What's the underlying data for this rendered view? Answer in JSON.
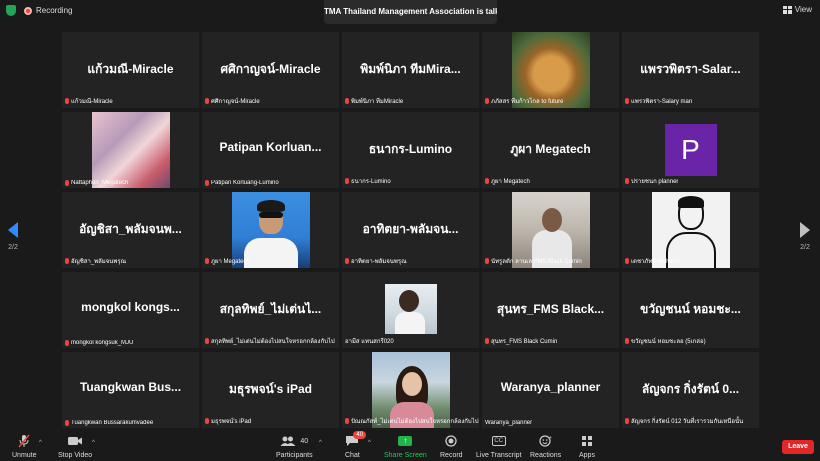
{
  "topbar": {
    "recording_label": "Recording",
    "talking_banner": "TMA Thailand Management Association is talking...",
    "view_label": "View"
  },
  "pager": {
    "left": "2/2",
    "right": "2/2"
  },
  "tiles": [
    {
      "big": "แก้วมณี-Miracle",
      "cap": "แก้วมณี-Miracle"
    },
    {
      "big": "ศศิกาญจน์-Miracle",
      "cap": "ศศิกาญจน์-Miracle"
    },
    {
      "big": "พิมพ์นิภา ทีมMira...",
      "cap": "พิมพ์นิภา ทีมMiracle"
    },
    {
      "big": "",
      "cap": "ภภัสสร ทีมก้าวไกล to future"
    },
    {
      "big": "แพรวพิตรา-Salar...",
      "cap": "แพรวพิตรา-Salary man"
    },
    {
      "big": "",
      "cap": "Nattaphon_Megatech"
    },
    {
      "big": "Patipan Korluan...",
      "cap": "Patipan Korluang-Lumino"
    },
    {
      "big": "ธนากร-Lumino",
      "cap": "ธนากร-Lumino"
    },
    {
      "big": "ภูผา Megatech",
      "cap": "ภูผา Megatech"
    },
    {
      "big": "P",
      "cap": "ปรายชนก planner"
    },
    {
      "big": "อัญชิสา_พลัมจนพ...",
      "cap": "อัญชิสา_พลัมจนพรุณ"
    },
    {
      "big": "",
      "cap": "ภูผา Megatech"
    },
    {
      "big": "อาทิตยา-พลัมจน...",
      "cap": "อาทิตยา-พลัมจนพรุณ"
    },
    {
      "big": "",
      "cap": "นัทรูลดัก ลานเล FMS Black Cumin"
    },
    {
      "big": "",
      "cap": "เตชาภัทร์ Wolvern"
    },
    {
      "big": "mongkol kongs...",
      "cap": "mongkol kongsuk_MJU"
    },
    {
      "big": "สกุลทิพย์_ไม่เต่นไ...",
      "cap": "สกุลทิพย์_ไม่เต่นไม่ต้องไปสนใจหรอกกล้องกับไป"
    },
    {
      "big": "",
      "cap": "อามีส แทนสกรี020"
    },
    {
      "big": "สุนทร_FMS Black...",
      "cap": "สุนทร_FMS Black Cumin"
    },
    {
      "big": "ขวัญชนน์ หอมชะ...",
      "cap": "ขวัญชนน์ หอมชะลอ (5เกล่อ)"
    },
    {
      "big": "Tuangkwan Bus...",
      "cap": "Tuangkwan Bussarakumvadee"
    },
    {
      "big": "มธุรพจน์'s iPad",
      "cap": "มธุรพจน์'s iPad"
    },
    {
      "big": "",
      "cap": "ปัณณกัสท์_ไม่เต่นไม่ต้องไปสนใจหรอกกล้องกับไป"
    },
    {
      "big": "Waranya_planner",
      "cap": "Waranya_planner"
    },
    {
      "big": "ลัญจกร กิ่งรัตน์ 0...",
      "cap": "ลัญจกร กิ่งรัตน์ 012 วันที่เรารวมกันเหนือนั้น"
    }
  ],
  "toolbar": {
    "unmute": "Unmute",
    "stop_video": "Stop Video",
    "participants": "Participants",
    "participants_count": "40",
    "chat": "Chat",
    "chat_badge": "40",
    "share_screen": "Share Screen",
    "record": "Record",
    "live_transcript": "Live Transcript",
    "reactions": "Reactions",
    "apps": "Apps",
    "leave": "Leave",
    "cc_text": "CC",
    "share_arrow": "↑"
  },
  "colors": {
    "leave": "#e02828",
    "share": "#22b34a",
    "arrow_active": "#2f8cff",
    "badge": "#e8453c"
  }
}
